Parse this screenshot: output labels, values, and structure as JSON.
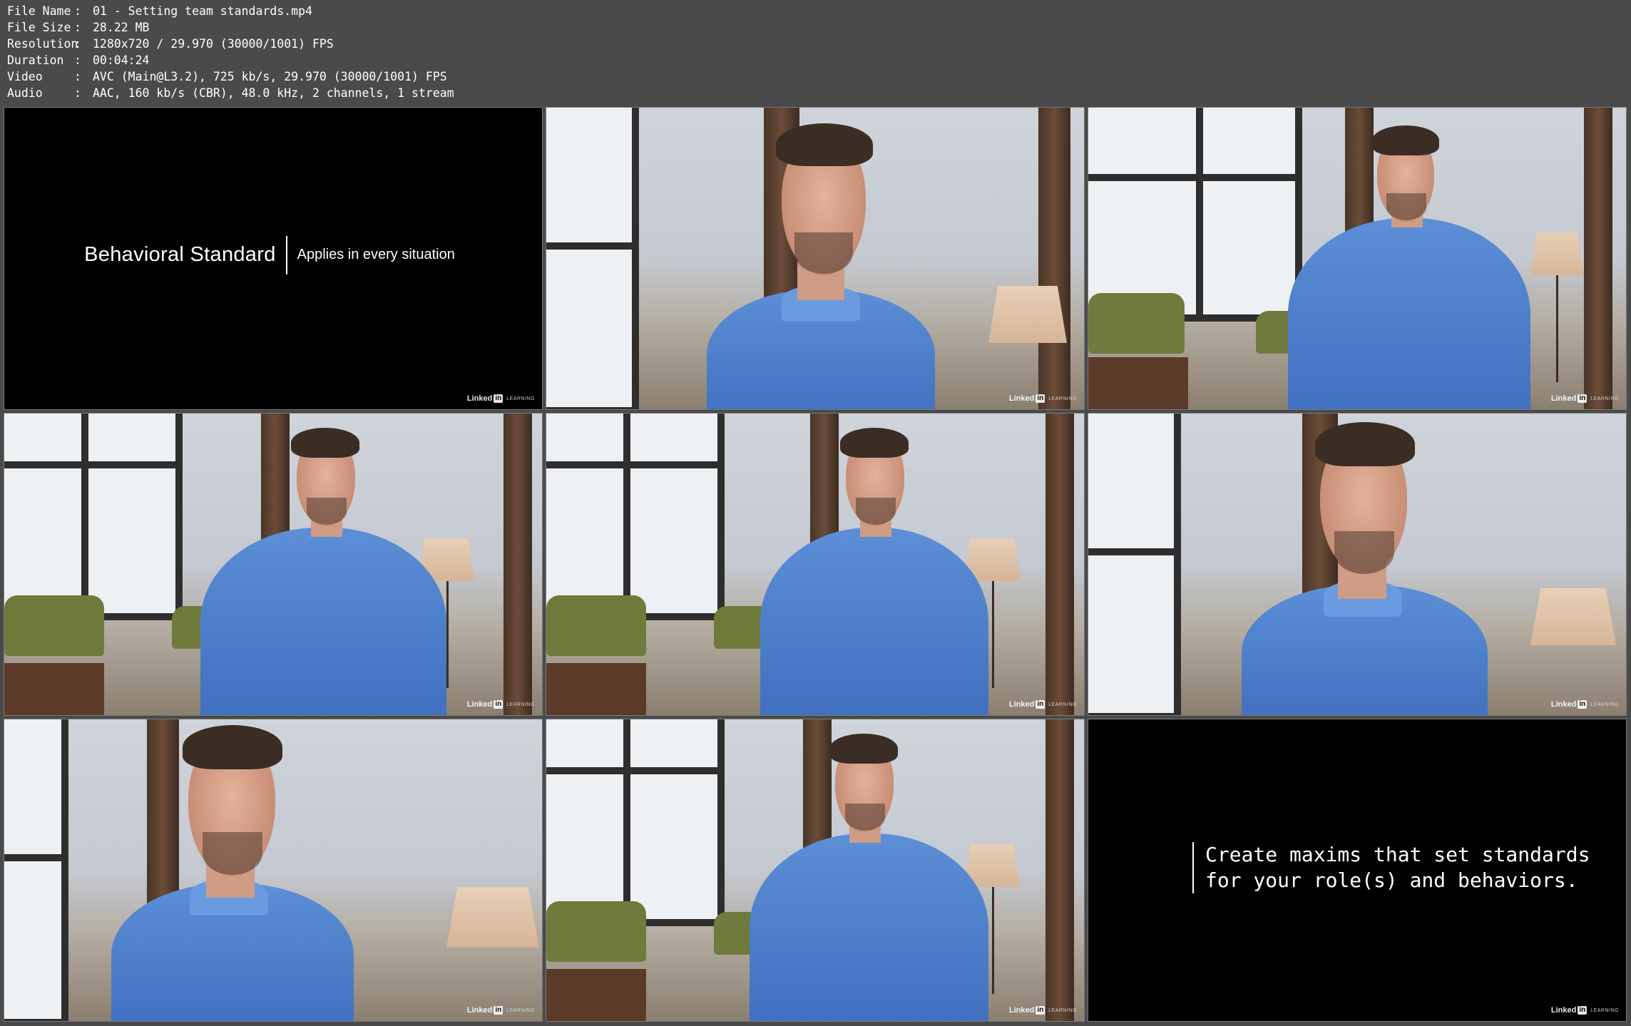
{
  "file_info": [
    {
      "label": "File Name",
      "value": "01 - Setting team standards.mp4"
    },
    {
      "label": "File Size",
      "value": "28.22 MB"
    },
    {
      "label": "Resolution",
      "value": "1280x720 / 29.970 (30000/1001) FPS"
    },
    {
      "label": "Duration",
      "value": "00:04:24"
    },
    {
      "label": "Video",
      "value": "AVC (Main@L3.2), 725 kb/s, 29.970 (30000/1001) FPS"
    },
    {
      "label": "Audio",
      "value": "AAC, 160 kb/s (CBR), 48.0 kHz, 2 channels, 1 stream"
    }
  ],
  "separator": ":",
  "thumbnails": {
    "title_card_1": {
      "main": "Behavioral Standard",
      "sub": "Applies in every situation"
    },
    "title_card_2": {
      "line1": "Create maxims that set standards",
      "line2": "for your role(s) and behaviors."
    },
    "watermark": {
      "brand": "Linked",
      "in": "in",
      "suffix": "LEARNING"
    }
  },
  "colors": {
    "background": "#4a4a4a",
    "shirt": "#4a7fcf",
    "title_card_bg": "#000000"
  }
}
